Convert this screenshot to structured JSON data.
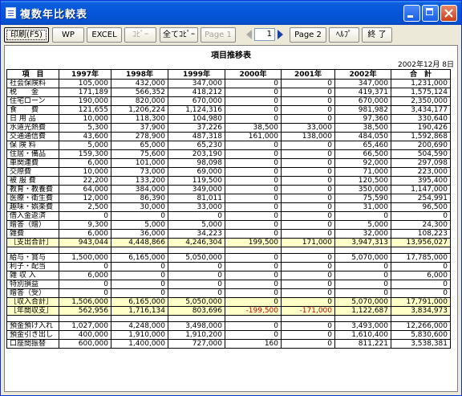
{
  "window": {
    "title": "複数年比較表"
  },
  "toolbar": {
    "print": "印刷(F5)",
    "wp": "WP",
    "excel": "EXCEL",
    "copy": "ｺﾋﾟｰ",
    "copy_all": "全てｺﾋﾟｰ",
    "page1": "Page 1",
    "page_value": "1",
    "page2": "Page 2",
    "help": "ﾍﾙﾌﾟ",
    "close": "終 了"
  },
  "report": {
    "title": "項目推移表",
    "date": "2002年12月 8日",
    "headers": [
      "項　目",
      "1997年",
      "1998年",
      "1999年",
      "2000年",
      "2001年",
      "2002年",
      "合　計"
    ],
    "rows": [
      {
        "label": "社会保険料",
        "values": [
          "105,000",
          "432,000",
          "347,000",
          "0",
          "0",
          "347,000",
          "1,231,000"
        ]
      },
      {
        "label": "税　　金",
        "values": [
          "171,189",
          "566,352",
          "418,212",
          "0",
          "0",
          "419,371",
          "1,575,124"
        ]
      },
      {
        "label": "住宅ローン",
        "values": [
          "190,000",
          "820,000",
          "670,000",
          "0",
          "0",
          "670,000",
          "2,350,000"
        ]
      },
      {
        "label": "食　　費",
        "values": [
          "121,655",
          "1,206,224",
          "1,124,316",
          "0",
          "0",
          "981,982",
          "3,434,177"
        ]
      },
      {
        "label": "日 用 品",
        "values": [
          "10,000",
          "118,300",
          "104,980",
          "0",
          "0",
          "97,360",
          "330,640"
        ]
      },
      {
        "label": "水道光熱費",
        "values": [
          "5,300",
          "37,900",
          "37,226",
          "38,500",
          "33,000",
          "38,500",
          "190,426"
        ]
      },
      {
        "label": "交通通信費",
        "values": [
          "43,600",
          "278,900",
          "487,318",
          "161,000",
          "138,000",
          "484,050",
          "1,592,868"
        ]
      },
      {
        "label": "保 険 料",
        "values": [
          "5,000",
          "65,000",
          "65,230",
          "0",
          "0",
          "65,460",
          "200,690"
        ]
      },
      {
        "label": "住居・備品",
        "values": [
          "159,300",
          "75,600",
          "203,190",
          "0",
          "0",
          "66,500",
          "504,590"
        ]
      },
      {
        "label": "車関連費",
        "values": [
          "6,000",
          "101,000",
          "98,098",
          "0",
          "0",
          "92,000",
          "297,098"
        ]
      },
      {
        "label": "交際費",
        "values": [
          "10,000",
          "73,000",
          "69,000",
          "0",
          "0",
          "71,000",
          "223,000"
        ]
      },
      {
        "label": "被 服 費",
        "values": [
          "22,200",
          "133,200",
          "119,500",
          "0",
          "0",
          "120,500",
          "395,400"
        ]
      },
      {
        "label": "教育・教養費",
        "values": [
          "64,000",
          "384,000",
          "349,000",
          "0",
          "0",
          "350,000",
          "1,147,000"
        ]
      },
      {
        "label": "医療・衛生費",
        "values": [
          "12,000",
          "86,390",
          "81,011",
          "0",
          "0",
          "75,590",
          "254,991"
        ]
      },
      {
        "label": "趣味・娯楽費",
        "values": [
          "2,500",
          "30,000",
          "33,000",
          "0",
          "0",
          "31,000",
          "96,500"
        ]
      },
      {
        "label": "借入金返済",
        "values": [
          "0",
          "0",
          "0",
          "0",
          "0",
          "0",
          "0"
        ]
      },
      {
        "label": "贈答（贈）",
        "values": [
          "9,300",
          "5,000",
          "5,000",
          "0",
          "0",
          "5,000",
          "24,300"
        ]
      },
      {
        "label": "雑費",
        "values": [
          "6,000",
          "36,000",
          "34,223",
          "0",
          "0",
          "32,000",
          "108,223"
        ]
      },
      {
        "label": "［支出合計］",
        "values": [
          "943,044",
          "4,448,866",
          "4,246,304",
          "199,500",
          "171,000",
          "3,947,313",
          "13,956,027"
        ],
        "highlight": true
      },
      {
        "spacer": true
      },
      {
        "label": "給与・賞与",
        "values": [
          "1,500,000",
          "6,165,000",
          "5,050,000",
          "0",
          "0",
          "5,070,000",
          "17,785,000"
        ]
      },
      {
        "label": "利子・配当",
        "values": [
          "0",
          "0",
          "0",
          "0",
          "0",
          "0",
          "0"
        ]
      },
      {
        "label": "雑 収 入",
        "values": [
          "6,000",
          "0",
          "0",
          "0",
          "0",
          "0",
          "6,000"
        ]
      },
      {
        "label": "特別損益",
        "values": [
          "0",
          "0",
          "0",
          "0",
          "0",
          "0",
          "0"
        ]
      },
      {
        "label": "贈答（受）",
        "values": [
          "0",
          "0",
          "0",
          "0",
          "0",
          "0",
          "0"
        ]
      },
      {
        "label": "［収入合計］",
        "values": [
          "1,506,000",
          "6,165,000",
          "5,050,000",
          "0",
          "0",
          "5,070,000",
          "17,791,000"
        ],
        "highlight": true
      },
      {
        "label": "［年間収支］",
        "values": [
          "562,956",
          "1,716,134",
          "803,696",
          "-199,500",
          "-171,000",
          "1,122,687",
          "3,834,973"
        ],
        "highlight": true,
        "neg": [
          3,
          4
        ]
      },
      {
        "spacer": true
      },
      {
        "label": "預金預け入れ",
        "values": [
          "1,027,000",
          "4,248,000",
          "3,498,000",
          "0",
          "0",
          "3,493,000",
          "12,266,000"
        ]
      },
      {
        "label": "預金引き出し",
        "values": [
          "400,000",
          "1,910,000",
          "1,910,200",
          "0",
          "0",
          "1,610,400",
          "5,830,600"
        ]
      },
      {
        "label": "口座間振替",
        "values": [
          "600,000",
          "1,400,000",
          "727,000",
          "160",
          "0",
          "811,221",
          "3,538,381"
        ]
      }
    ]
  }
}
